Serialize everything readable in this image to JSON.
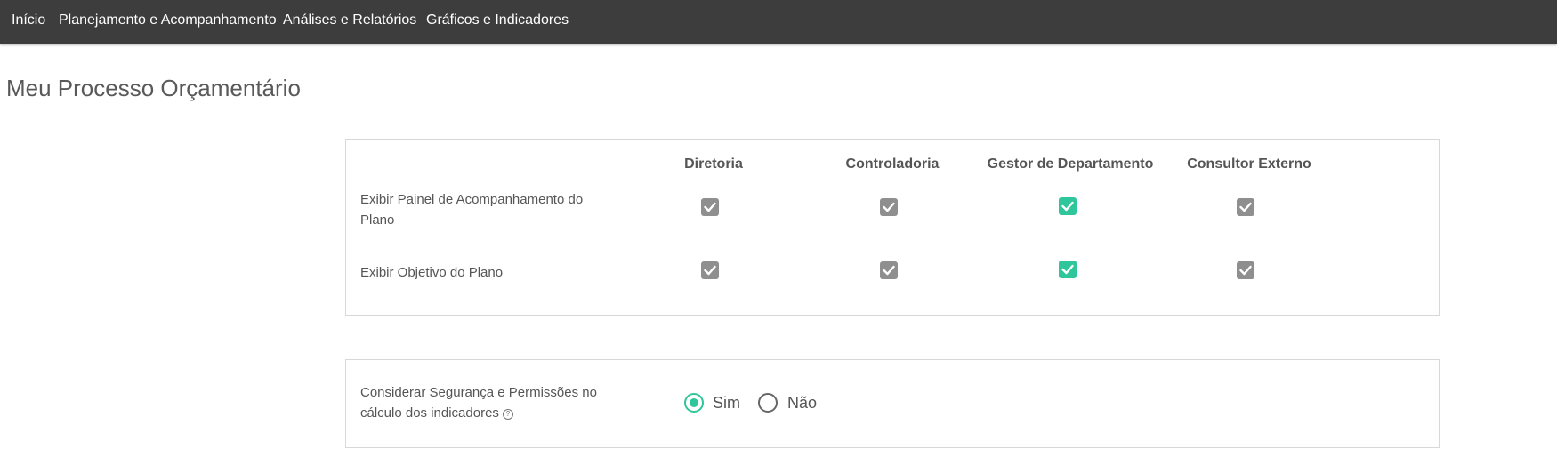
{
  "nav": {
    "items": [
      {
        "label": "Início"
      },
      {
        "label": "Planejamento e Acompanhamento"
      },
      {
        "label": "Análises e Relatórios"
      },
      {
        "label": "Gráficos e Indicadores"
      }
    ]
  },
  "page": {
    "title": "Meu Processo Orçamentário"
  },
  "permissions": {
    "columns": [
      "Diretoria",
      "Controladoria",
      "Gestor de Departamento",
      "Consultor Externo"
    ],
    "rows": [
      {
        "label": "Exibir Painel de Acompanhamento do Plano",
        "values": [
          {
            "checked": true,
            "state": "disabled"
          },
          {
            "checked": true,
            "state": "disabled"
          },
          {
            "checked": true,
            "state": "enabled"
          },
          {
            "checked": true,
            "state": "disabled"
          }
        ]
      },
      {
        "label": "Exibir Objetivo do Plano",
        "values": [
          {
            "checked": true,
            "state": "disabled"
          },
          {
            "checked": true,
            "state": "disabled"
          },
          {
            "checked": true,
            "state": "enabled"
          },
          {
            "checked": true,
            "state": "disabled"
          }
        ]
      }
    ]
  },
  "security": {
    "label": "Considerar Segurança e Permissões no cálculo dos indicadores",
    "help_icon": "question-circle-icon",
    "options": [
      {
        "label": "Sim",
        "selected": true
      },
      {
        "label": "Não",
        "selected": false
      }
    ]
  },
  "colors": {
    "nav_bg": "#3d3d3d",
    "accent": "#2ec69a",
    "disabled_check": "#8f8f8f"
  }
}
